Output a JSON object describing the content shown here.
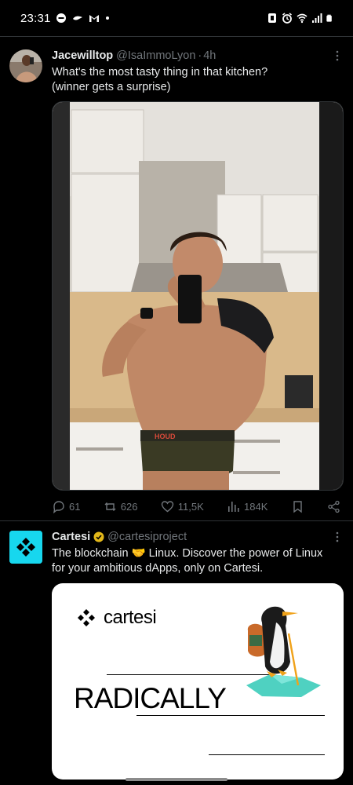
{
  "status_bar": {
    "time": "23:31"
  },
  "tweet1": {
    "name": "Jacewilltop",
    "handle": "@IsaImmoLyon",
    "dot": "·",
    "time": "4h",
    "text_line1": "What's the most tasty thing in that kitchen?",
    "text_line2": "(winner gets a surprise)",
    "media_icon": "mirror-selfie-photo",
    "underwear_brand": "HOUD",
    "actions": {
      "replies": "61",
      "reposts": "626",
      "likes": "11,5K",
      "views": "184K"
    }
  },
  "tweet2": {
    "name": "Cartesi",
    "handle": "@cartesiproject",
    "text_line1_a": "The blockchain",
    "text_line1_emoji": "🤝",
    "text_line1_b": "Linux. Discover the power of Linux",
    "text_line2": "for your ambitious dApps, only on Cartesi.",
    "card": {
      "logo_text": "cartesi",
      "headline": "RADICALLY"
    }
  },
  "colors": {
    "background": "#000000",
    "text_primary": "#e7e9ea",
    "text_secondary": "#71767b",
    "divider": "#2f3336",
    "cartesi_avatar": "#17d7ee",
    "verified_badge": "#e2b719"
  }
}
